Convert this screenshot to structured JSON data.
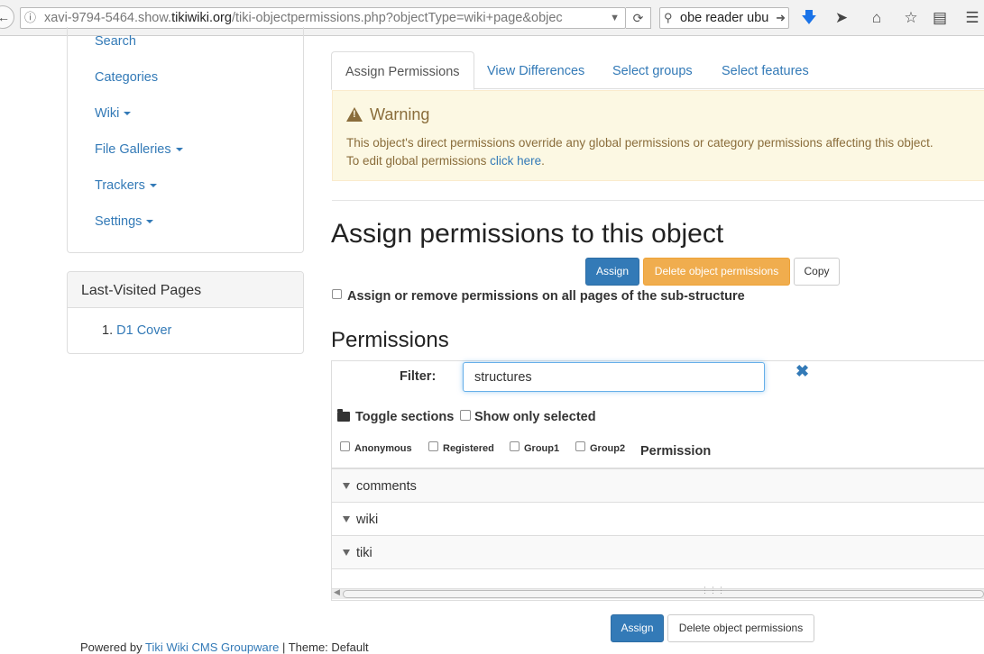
{
  "browser": {
    "url_prefix": "xavi-9794-5464.show.",
    "url_domain": "tikiwiki.org",
    "url_path": "/tiki-objectpermissions.php?objectType=wiki+page&objec",
    "search_text": "obe reader ubu"
  },
  "sidebar": {
    "items": [
      {
        "label": "Search",
        "dropdown": false
      },
      {
        "label": "Categories",
        "dropdown": false
      },
      {
        "label": "Wiki",
        "dropdown": true
      },
      {
        "label": "File Galleries",
        "dropdown": true
      },
      {
        "label": "Trackers",
        "dropdown": true
      },
      {
        "label": "Settings",
        "dropdown": true
      }
    ],
    "last_visited_title": "Last-Visited Pages",
    "last_visited": [
      {
        "num": "1.",
        "label": "D1 Cover"
      }
    ]
  },
  "tabs": [
    "Assign Permissions",
    "View Differences",
    "Select groups",
    "Select features"
  ],
  "warning": {
    "title": "Warning",
    "text": "This object's direct permissions override any global permissions or category permissions affecting this object.",
    "text2": "To edit global permissions ",
    "link": "click here",
    "after_link": "."
  },
  "main": {
    "heading": "Assign permissions to this object",
    "assign_label": "Assign",
    "delete_label": "Delete object permissions",
    "copy_label": "Copy",
    "substructure_label": "Assign or remove permissions on all pages of the sub-structure",
    "permissions_heading": "Permissions"
  },
  "permissions": {
    "filter_label": "Filter:",
    "filter_value": "structures",
    "toggle_sections": "Toggle sections",
    "show_only_selected": "Show only selected",
    "groups": [
      "Anonymous",
      "Registered",
      "Group1",
      "Group2"
    ],
    "permission_col": "Permission",
    "categories": [
      "comments",
      "wiki",
      "tiki"
    ]
  },
  "bottom": {
    "assign_label": "Assign",
    "delete_label": "Delete object permissions"
  },
  "footer": {
    "text": "Powered by ",
    "link": "Tiki Wiki CMS Groupware",
    "rest": " | Theme: Default"
  }
}
